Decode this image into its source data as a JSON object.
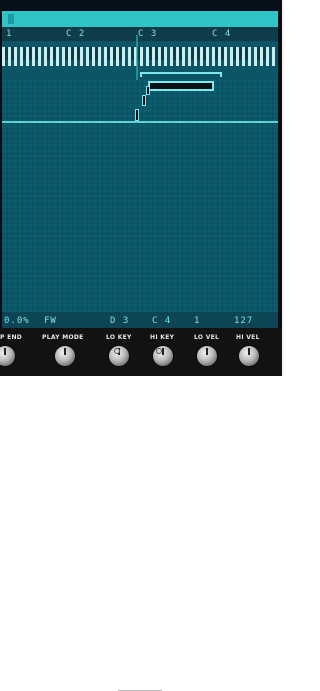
{
  "keyboard": {
    "octave_labels": [
      "1",
      "C 2",
      "C 3",
      "C 4"
    ]
  },
  "status": {
    "pct": "0.0%",
    "mode": "FW",
    "lo_key": "D 3",
    "hi_key": "C 4",
    "lo_vel": "1",
    "hi_vel": "127"
  },
  "knobs": [
    {
      "label": "P END"
    },
    {
      "label": "PLAY MODE"
    },
    {
      "label": "LO KEY"
    },
    {
      "label": "HI KEY"
    },
    {
      "label": "LO VEL"
    },
    {
      "label": "HI VEL"
    }
  ],
  "colors": {
    "top_bar": "#30c4c4",
    "panel": "#0c5c70",
    "accent": "#7fe8ea"
  }
}
